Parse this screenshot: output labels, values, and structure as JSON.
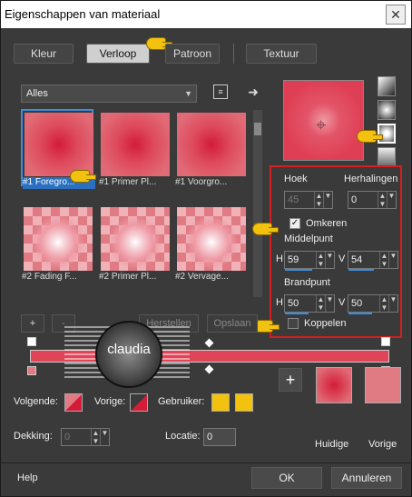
{
  "window": {
    "title": "Eigenschappen van materiaal",
    "close_glyph": "✕"
  },
  "tabs": [
    {
      "label": "Kleur"
    },
    {
      "label": "Verloop"
    },
    {
      "label": "Patroon"
    },
    {
      "label": "Textuur"
    }
  ],
  "gallery": {
    "dropdown_value": "Alles",
    "items": [
      {
        "label": "#1 Foregro..."
      },
      {
        "label": "#1 Primer Pl..."
      },
      {
        "label": "#1 Voorgro..."
      },
      {
        "label": "#2 Fading F..."
      },
      {
        "label": "#2 Primer Pl..."
      },
      {
        "label": "#2 Vervage..."
      }
    ]
  },
  "settings": {
    "hoek_label": "Hoek",
    "hoek_value": "45",
    "herhalingen_label": "Herhalingen",
    "herhalingen_value": "0",
    "omkeren_label": "Omkeren",
    "middelpunt_label": "Middelpunt",
    "mid_h_label": "H",
    "mid_h_value": "59",
    "mid_v_label": "V",
    "mid_v_value": "54",
    "brandpunt_label": "Brandpunt",
    "brand_h_label": "H",
    "brand_h_value": "50",
    "brand_v_label": "V",
    "brand_v_value": "50",
    "koppelen_label": "Koppelen"
  },
  "gradient_tools": {
    "add_label": "+",
    "remove_label": "-",
    "herstellen_label": "Herstellen",
    "opslaan_label": "Opslaan"
  },
  "watermark": {
    "text": "claudia"
  },
  "colors": {
    "volgende_label": "Volgende:",
    "vorige_label": "Vorige:",
    "gebruiker_label": "Gebruiker:",
    "dekking_label": "Dekking:",
    "dekking_value": "0",
    "locatie_label": "Locatie:",
    "locatie_value": "0",
    "huidige_label": "Huidige",
    "vorige_swatch_label": "Vorige",
    "accent_red": "#df3f55",
    "accent_yellow": "#f2c20e"
  },
  "footer": {
    "help_label": "Help",
    "ok_label": "OK",
    "cancel_label": "Annuleren"
  }
}
